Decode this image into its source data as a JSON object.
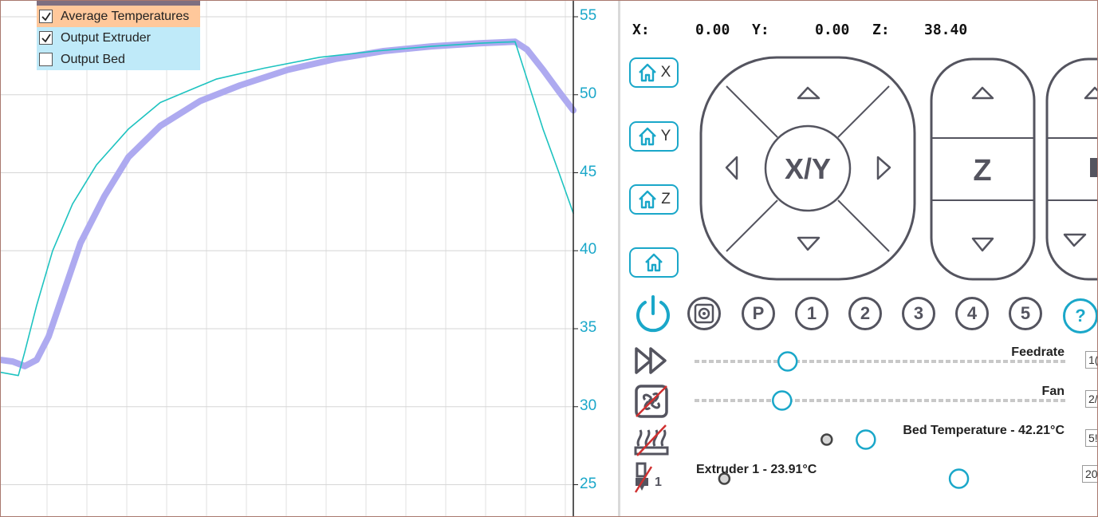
{
  "chart": {
    "legend": [
      {
        "label": "Average Temperatures",
        "checked": true,
        "highlight": true
      },
      {
        "label": "Output Extruder",
        "checked": true,
        "highlight": false
      },
      {
        "label": "Output Bed",
        "checked": false,
        "highlight": false
      }
    ],
    "y_ticks": [
      "55",
      "50",
      "45",
      "40",
      "35",
      "30",
      "25"
    ],
    "colors": {
      "average": "#aeaaf0",
      "extruder": "#1ec3c0",
      "axis": "#1aa7c9"
    }
  },
  "chart_data": {
    "type": "line",
    "ylim": [
      23,
      56
    ],
    "x_range": [
      0,
      718
    ],
    "series": [
      {
        "key": "average",
        "points": [
          [
            0,
            33.0
          ],
          [
            15,
            32.9
          ],
          [
            30,
            32.6
          ],
          [
            45,
            33.0
          ],
          [
            60,
            34.5
          ],
          [
            80,
            37.5
          ],
          [
            100,
            40.5
          ],
          [
            130,
            43.5
          ],
          [
            160,
            46.0
          ],
          [
            200,
            48.0
          ],
          [
            250,
            49.6
          ],
          [
            300,
            50.6
          ],
          [
            360,
            51.6
          ],
          [
            420,
            52.3
          ],
          [
            480,
            52.8
          ],
          [
            540,
            53.1
          ],
          [
            600,
            53.3
          ],
          [
            645,
            53.4
          ],
          [
            660,
            52.9
          ],
          [
            680,
            51.6
          ],
          [
            700,
            50.2
          ],
          [
            718,
            49.0
          ]
        ]
      },
      {
        "key": "extruder",
        "points": [
          [
            0,
            32.2
          ],
          [
            22,
            32.0
          ],
          [
            30,
            33.5
          ],
          [
            45,
            36.5
          ],
          [
            65,
            40.0
          ],
          [
            90,
            43.0
          ],
          [
            120,
            45.5
          ],
          [
            160,
            47.8
          ],
          [
            200,
            49.5
          ],
          [
            228,
            50.1
          ],
          [
            270,
            51.0
          ],
          [
            330,
            51.7
          ],
          [
            400,
            52.4
          ],
          [
            470,
            52.8
          ],
          [
            540,
            53.1
          ],
          [
            600,
            53.3
          ],
          [
            645,
            53.4
          ],
          [
            660,
            51.0
          ],
          [
            680,
            47.8
          ],
          [
            700,
            45.0
          ],
          [
            718,
            42.4
          ]
        ]
      }
    ]
  },
  "control": {
    "coords": {
      "x_label": "X:",
      "x_value": "0.00",
      "y_label": "Y:",
      "y_value": "0.00",
      "z_label": "Z:",
      "z_value": "38.40"
    },
    "home_buttons": [
      "X",
      "Y",
      "Z",
      ""
    ],
    "xy_label": "X/Y",
    "z_label": "Z",
    "macro_buttons": [
      "P",
      "1",
      "2",
      "3",
      "4",
      "5"
    ],
    "help_label": "?",
    "sliders": [
      {
        "key": "feedrate",
        "label": "Feedrate",
        "value_text": "1(",
        "level": 0.25
      },
      {
        "key": "fan",
        "label": "Fan",
        "value_text": "2/",
        "level": 0.235
      },
      {
        "key": "bed",
        "label": "Bed Temperature - 42.21°C",
        "value_text": "5!",
        "level": 0.46,
        "current_level": 0.355
      },
      {
        "key": "extruder1",
        "label": "Extruder 1 - 23.91°C",
        "value_text": "20",
        "level": 0.71,
        "current_level": 0.08
      }
    ],
    "extruder_number": "1",
    "colors": {
      "accent": "#1aa7c9",
      "dark": "#54545f"
    }
  }
}
